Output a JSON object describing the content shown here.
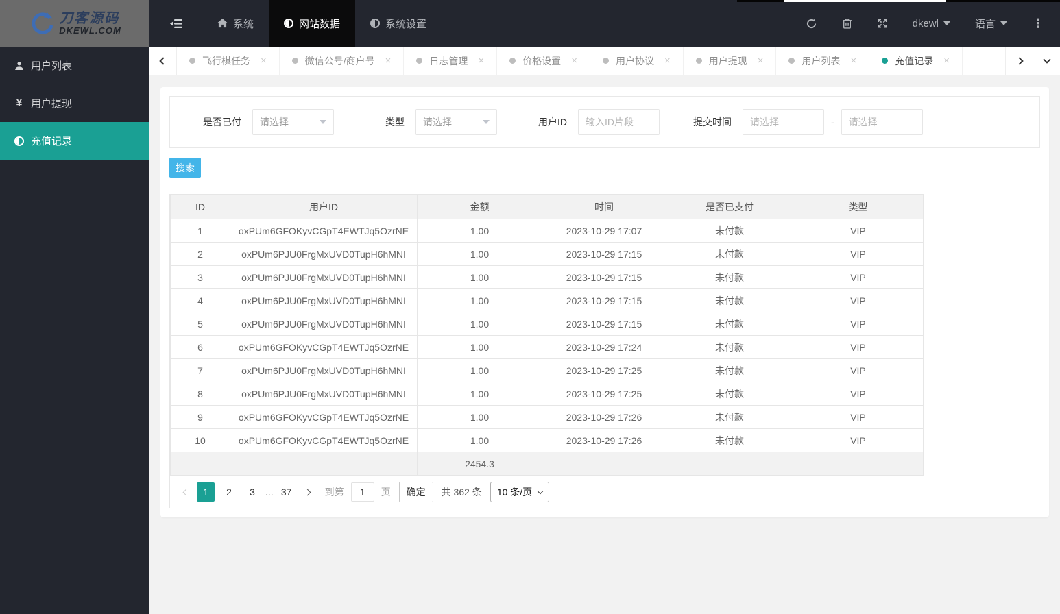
{
  "topbar": {
    "logo": {
      "title": "刀客源码",
      "subtitle": "DKEWL.COM"
    },
    "menu": [
      {
        "label": "系统",
        "icon": "home-icon"
      },
      {
        "label": "网站数据",
        "icon": "circle-half-icon",
        "active": true
      },
      {
        "label": "系统设置",
        "icon": "circle-half-icon"
      }
    ],
    "user_label": "dkewl",
    "language_label": "语言"
  },
  "tabs": [
    {
      "label": "飞行棋任务"
    },
    {
      "label": "微信公号/商户号"
    },
    {
      "label": "日志管理"
    },
    {
      "label": "价格设置"
    },
    {
      "label": "用户协议"
    },
    {
      "label": "用户提现"
    },
    {
      "label": "用户列表"
    },
    {
      "label": "充值记录",
      "active": true
    }
  ],
  "sidebar": [
    {
      "label": "用户列表",
      "icon": "user-icon"
    },
    {
      "label": "用户提现",
      "icon": "yen-icon"
    },
    {
      "label": "充值记录",
      "icon": "circle-half-icon",
      "active": true
    }
  ],
  "filter": {
    "paid_label": "是否已付",
    "paid_value": "请选择",
    "type_label": "类型",
    "type_value": "请选择",
    "userid_label": "用户ID",
    "userid_placeholder": "输入ID片段",
    "time_label": "提交时间",
    "time_start_placeholder": "请选择",
    "time_end_placeholder": "请选择",
    "range_separator": "-"
  },
  "search_button_label": "搜索",
  "table": {
    "columns": [
      "ID",
      "用户ID",
      "金额",
      "时间",
      "是否已支付",
      "类型"
    ],
    "rows": [
      [
        "1",
        "oxPUm6GFOKyvCGpT4EWTJq5OzrNE",
        "1.00",
        "2023-10-29 17:07",
        "未付款",
        "VIP"
      ],
      [
        "2",
        "oxPUm6PJU0FrgMxUVD0TupH6hMNI",
        "1.00",
        "2023-10-29 17:15",
        "未付款",
        "VIP"
      ],
      [
        "3",
        "oxPUm6PJU0FrgMxUVD0TupH6hMNI",
        "1.00",
        "2023-10-29 17:15",
        "未付款",
        "VIP"
      ],
      [
        "4",
        "oxPUm6PJU0FrgMxUVD0TupH6hMNI",
        "1.00",
        "2023-10-29 17:15",
        "未付款",
        "VIP"
      ],
      [
        "5",
        "oxPUm6PJU0FrgMxUVD0TupH6hMNI",
        "1.00",
        "2023-10-29 17:15",
        "未付款",
        "VIP"
      ],
      [
        "6",
        "oxPUm6GFOKyvCGpT4EWTJq5OzrNE",
        "1.00",
        "2023-10-29 17:24",
        "未付款",
        "VIP"
      ],
      [
        "7",
        "oxPUm6PJU0FrgMxUVD0TupH6hMNI",
        "1.00",
        "2023-10-29 17:25",
        "未付款",
        "VIP"
      ],
      [
        "8",
        "oxPUm6PJU0FrgMxUVD0TupH6hMNI",
        "1.00",
        "2023-10-29 17:25",
        "未付款",
        "VIP"
      ],
      [
        "9",
        "oxPUm6GFOKyvCGpT4EWTJq5OzrNE",
        "1.00",
        "2023-10-29 17:26",
        "未付款",
        "VIP"
      ],
      [
        "10",
        "oxPUm6GFOKyvCGpT4EWTJq5OzrNE",
        "1.00",
        "2023-10-29 17:26",
        "未付款",
        "VIP"
      ]
    ],
    "total_amount": "2454.3"
  },
  "pagination": {
    "pages": [
      "1",
      "2",
      "3",
      "...",
      "37"
    ],
    "current_page": "1",
    "jump_prefix": "到第",
    "jump_value": "1",
    "jump_suffix": "页",
    "confirm_label": "确定",
    "total_label": "共 362 条",
    "per_page_label": "10 条/页"
  }
}
